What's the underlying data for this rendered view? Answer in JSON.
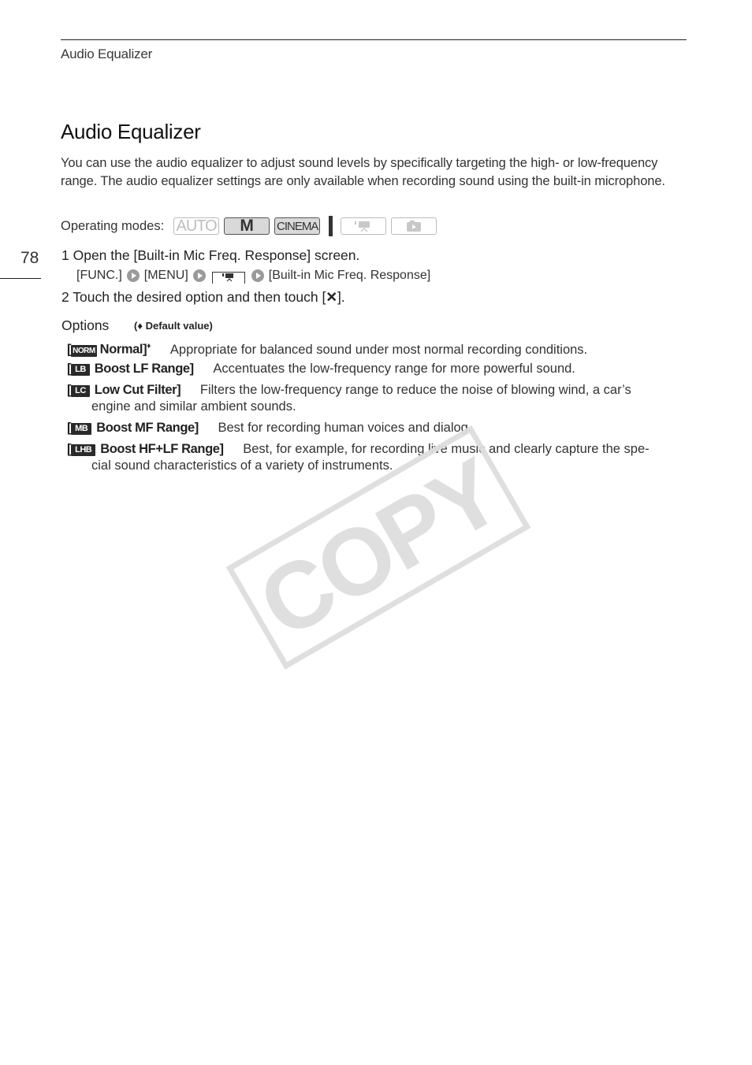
{
  "header": {
    "section": "Audio Equalizer"
  },
  "page_number": "78",
  "title": "Audio Equalizer",
  "intro": "You can use the audio equalizer to adjust sound levels by specifically targeting the high- or low-frequency range. The audio equalizer settings are only available when recording sound using the built-in microphone.",
  "operating_modes": {
    "label": "Operating modes:",
    "modes": [
      {
        "label": "AUTO",
        "icon": "auto-mode-icon",
        "enabled": false
      },
      {
        "label": "M",
        "icon": "manual-mode-icon",
        "enabled": true
      },
      {
        "label": "CINEMA",
        "icon": "cinema-mode-icon",
        "enabled": true
      },
      {
        "label": "",
        "icon": "movie-playback-icon",
        "enabled": false
      },
      {
        "label": "",
        "icon": "photo-playback-icon",
        "enabled": false
      }
    ]
  },
  "steps": [
    {
      "number": "1",
      "text": "Open the [Built-in Mic Freq. Response] screen."
    },
    {
      "number": "2",
      "text": "Touch the desired option and then touch [",
      "text_end": "]."
    }
  ],
  "menu_path": [
    "[FUNC.]",
    "[MENU]",
    "",
    "[Built-in Mic Freq. Response]"
  ],
  "close_icon": "✕",
  "options": {
    "title": "Options",
    "default_note": "Default value)",
    "default_marker": "♦",
    "items": [
      {
        "badge": "NORM",
        "name": "Normal]",
        "default": true,
        "desc": "Appropriate for balanced sound under most normal recording conditions.",
        "cont": ""
      },
      {
        "badge": "LB",
        "name": "Boost LF Range]",
        "default": false,
        "desc": "Accentuates the low-frequency range for more powerful sound.",
        "cont": ""
      },
      {
        "badge": "LC",
        "name": "Low Cut Filter]",
        "default": false,
        "desc": "Filters the low-frequency range to reduce the noise of blowing wind, a car’s",
        "cont": "engine and similar ambient sounds."
      },
      {
        "badge": "MB",
        "name": "Boost MF Range]",
        "default": false,
        "desc": "Best for recording human voices and dialog.",
        "cont": ""
      },
      {
        "badge": "LHB",
        "name": "Boost HF+LF Range]",
        "default": false,
        "desc": "Best, for example, for recording live music and clearly capture the spe-",
        "cont": "cial sound characteristics of a variety of instruments."
      }
    ]
  },
  "watermark": "COPY"
}
